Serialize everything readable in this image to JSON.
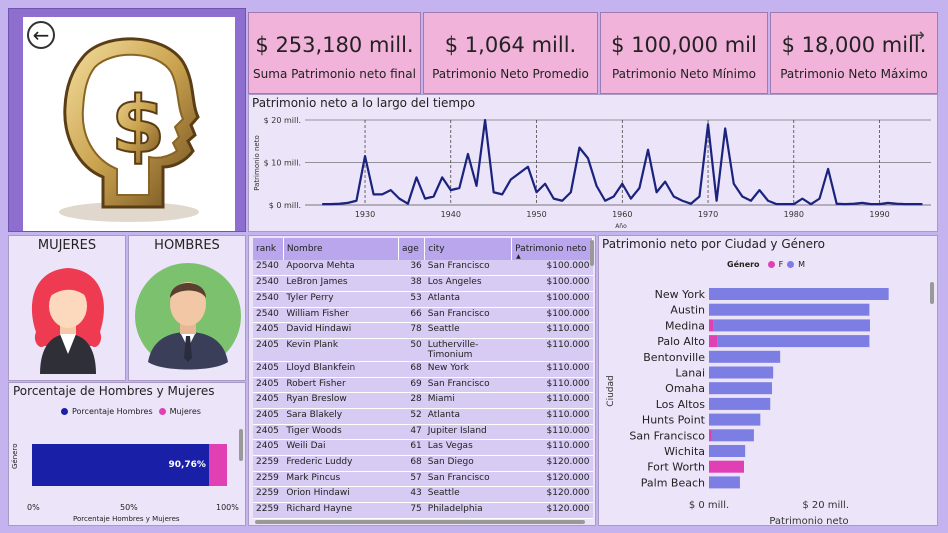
{
  "navigation": {
    "back_icon": "back-arrow-icon",
    "forward_icon": "forward-arrow-icon"
  },
  "kpis": [
    {
      "value": "$ 253,180 mill.",
      "label": "Suma Patrimonio neto final"
    },
    {
      "value": "$ 1,064 mill.",
      "label": "Patrimonio Neto Promedio"
    },
    {
      "value": "$ 100,000 mil",
      "label": "Patrimonio Neto Mínimo"
    },
    {
      "value": "$ 18,000 mill.",
      "label": "Patrimonio Neto Máximo"
    }
  ],
  "gender": {
    "women_label": "MUJERES",
    "men_label": "HOMBRES"
  },
  "line_chart": {
    "title": "Patrimonio neto a lo largo del tiempo",
    "ylabel": "Patrimonio neto",
    "xlabel": "Año",
    "yticks": [
      "$ 20 mill.",
      "$ 10 mill.",
      "$ 0 mill."
    ],
    "xticks": [
      "1930",
      "1940",
      "1950",
      "1960",
      "1970",
      "1980",
      "1990"
    ]
  },
  "pct_chart": {
    "title": "Porcentaje de Hombres y Mujeres",
    "legend_men": "Porcentaje Hombres",
    "legend_women": "Mujeres",
    "ylabel": "Género",
    "xlabel": "Porcentaje Hombres y Mujeres",
    "xticks": [
      "0%",
      "50%",
      "100%"
    ],
    "bar_label": "90,76%"
  },
  "table": {
    "columns": [
      "rank",
      "Nombre",
      "age",
      "city",
      "Patrimonio neto"
    ],
    "rows": [
      [
        "2540",
        "Apoorva Mehta",
        "36",
        "San Francisco",
        "$100.000"
      ],
      [
        "2540",
        "LeBron James",
        "38",
        "Los Angeles",
        "$100.000"
      ],
      [
        "2540",
        "Tyler Perry",
        "53",
        "Atlanta",
        "$100.000"
      ],
      [
        "2540",
        "William Fisher",
        "66",
        "San Francisco",
        "$100.000"
      ],
      [
        "2405",
        "David Hindawi",
        "78",
        "Seattle",
        "$110.000"
      ],
      [
        "2405",
        "Kevin Plank",
        "50",
        "Lutherville-Timonium",
        "$110.000"
      ],
      [
        "2405",
        "Lloyd Blankfein",
        "68",
        "New York",
        "$110.000"
      ],
      [
        "2405",
        "Robert Fisher",
        "69",
        "San Francisco",
        "$110.000"
      ],
      [
        "2405",
        "Ryan Breslow",
        "28",
        "Miami",
        "$110.000"
      ],
      [
        "2405",
        "Sara Blakely",
        "52",
        "Atlanta",
        "$110.000"
      ],
      [
        "2405",
        "Tiger Woods",
        "47",
        "Jupiter Island",
        "$110.000"
      ],
      [
        "2405",
        "Weili Dai",
        "61",
        "Las Vegas",
        "$110.000"
      ],
      [
        "2259",
        "Frederic Luddy",
        "68",
        "San Diego",
        "$120.000"
      ],
      [
        "2259",
        "Mark Pincus",
        "57",
        "San Francisco",
        "$120.000"
      ],
      [
        "2259",
        "Orion Hindawi",
        "43",
        "Seattle",
        "$120.000"
      ],
      [
        "2259",
        "Richard Hayne",
        "75",
        "Philadelphia",
        "$120.000"
      ]
    ]
  },
  "bar_chart": {
    "title": "Patrimonio neto por Ciudad y Género",
    "legend_title": "Género",
    "legend_f": "F",
    "legend_m": "M",
    "ylabel": "Ciudad",
    "xlabel": "Patrimonio neto",
    "xticks": [
      "$ 0 mill.",
      "$ 20 mill."
    ]
  },
  "chart_data": [
    {
      "type": "line",
      "title": "Patrimonio neto a lo largo del tiempo",
      "xlabel": "Año",
      "ylabel": "Patrimonio neto",
      "ylim": [
        0,
        20
      ],
      "xlim": [
        1923,
        1996
      ],
      "x": [
        1925,
        1926,
        1927,
        1928,
        1929,
        1930,
        1931,
        1932,
        1933,
        1934,
        1935,
        1936,
        1937,
        1938,
        1939,
        1940,
        1941,
        1942,
        1943,
        1944,
        1945,
        1946,
        1947,
        1948,
        1949,
        1950,
        1951,
        1952,
        1953,
        1954,
        1955,
        1956,
        1957,
        1958,
        1959,
        1960,
        1961,
        1962,
        1963,
        1964,
        1965,
        1966,
        1967,
        1968,
        1969,
        1970,
        1971,
        1972,
        1973,
        1974,
        1975,
        1976,
        1977,
        1978,
        1979,
        1980,
        1981,
        1982,
        1983,
        1984,
        1985,
        1986,
        1987,
        1988,
        1989,
        1990,
        1991,
        1992,
        1993,
        1994,
        1995
      ],
      "values": [
        0.2,
        0.2,
        0.3,
        0.5,
        1.0,
        11.5,
        2.5,
        2.5,
        3.5,
        1.5,
        0.3,
        6.5,
        1.5,
        2.0,
        6.5,
        3.5,
        4.0,
        12.0,
        4.5,
        20.0,
        3.0,
        2.5,
        6.0,
        7.5,
        9.0,
        3.0,
        5.0,
        1.5,
        1.0,
        3.0,
        13.5,
        11.0,
        4.5,
        1.0,
        2.0,
        5.0,
        1.5,
        4.0,
        13.0,
        3.0,
        5.5,
        2.0,
        1.0,
        0.3,
        2.0,
        19.0,
        1.0,
        18.0,
        5.0,
        2.0,
        1.0,
        3.5,
        1.0,
        0.2,
        0.2,
        0.2,
        1.5,
        0.2,
        1.5,
        8.5,
        0.3,
        0.2,
        0.3,
        0.5,
        0.2,
        0.2,
        0.5,
        0.3,
        0.2,
        0.2,
        0.2
      ]
    },
    {
      "type": "bar",
      "title": "Porcentaje de Hombres y Mujeres",
      "xlabel": "Porcentaje Hombres y Mujeres",
      "ylabel": "Género",
      "series": [
        {
          "name": "Porcentaje Hombres",
          "values": [
            90.76
          ]
        },
        {
          "name": "Mujeres",
          "values": [
            9.24
          ]
        }
      ],
      "xlim": [
        0,
        100
      ]
    },
    {
      "type": "bar",
      "title": "Patrimonio neto por Ciudad y Género",
      "xlabel": "Patrimonio neto",
      "ylabel": "Ciudad",
      "categories": [
        "New York",
        "Austin",
        "Medina",
        "Palo Alto",
        "Bentonville",
        "Lanai",
        "Omaha",
        "Los Altos",
        "Hunts Point",
        "San Francisco",
        "Wichita",
        "Fort Worth",
        "Palm Beach"
      ],
      "series": [
        {
          "name": "F",
          "values": [
            0,
            0,
            0.8,
            1.5,
            0,
            0,
            0,
            0,
            0,
            0.5,
            0,
            6.0,
            0
          ]
        },
        {
          "name": "M",
          "values": [
            30.8,
            27.5,
            26.8,
            26.0,
            12.2,
            11.0,
            10.8,
            10.5,
            8.8,
            7.2,
            6.2,
            0,
            5.3
          ]
        }
      ],
      "xlim": [
        0,
        36
      ]
    }
  ],
  "colors": {
    "line": "#1a237e",
    "men": "#1a1fa8",
    "women": "#e040b4",
    "bar_m": "#7c7ee3",
    "kpi_bg": "#f1b3da",
    "panel": "#ece4f8"
  }
}
